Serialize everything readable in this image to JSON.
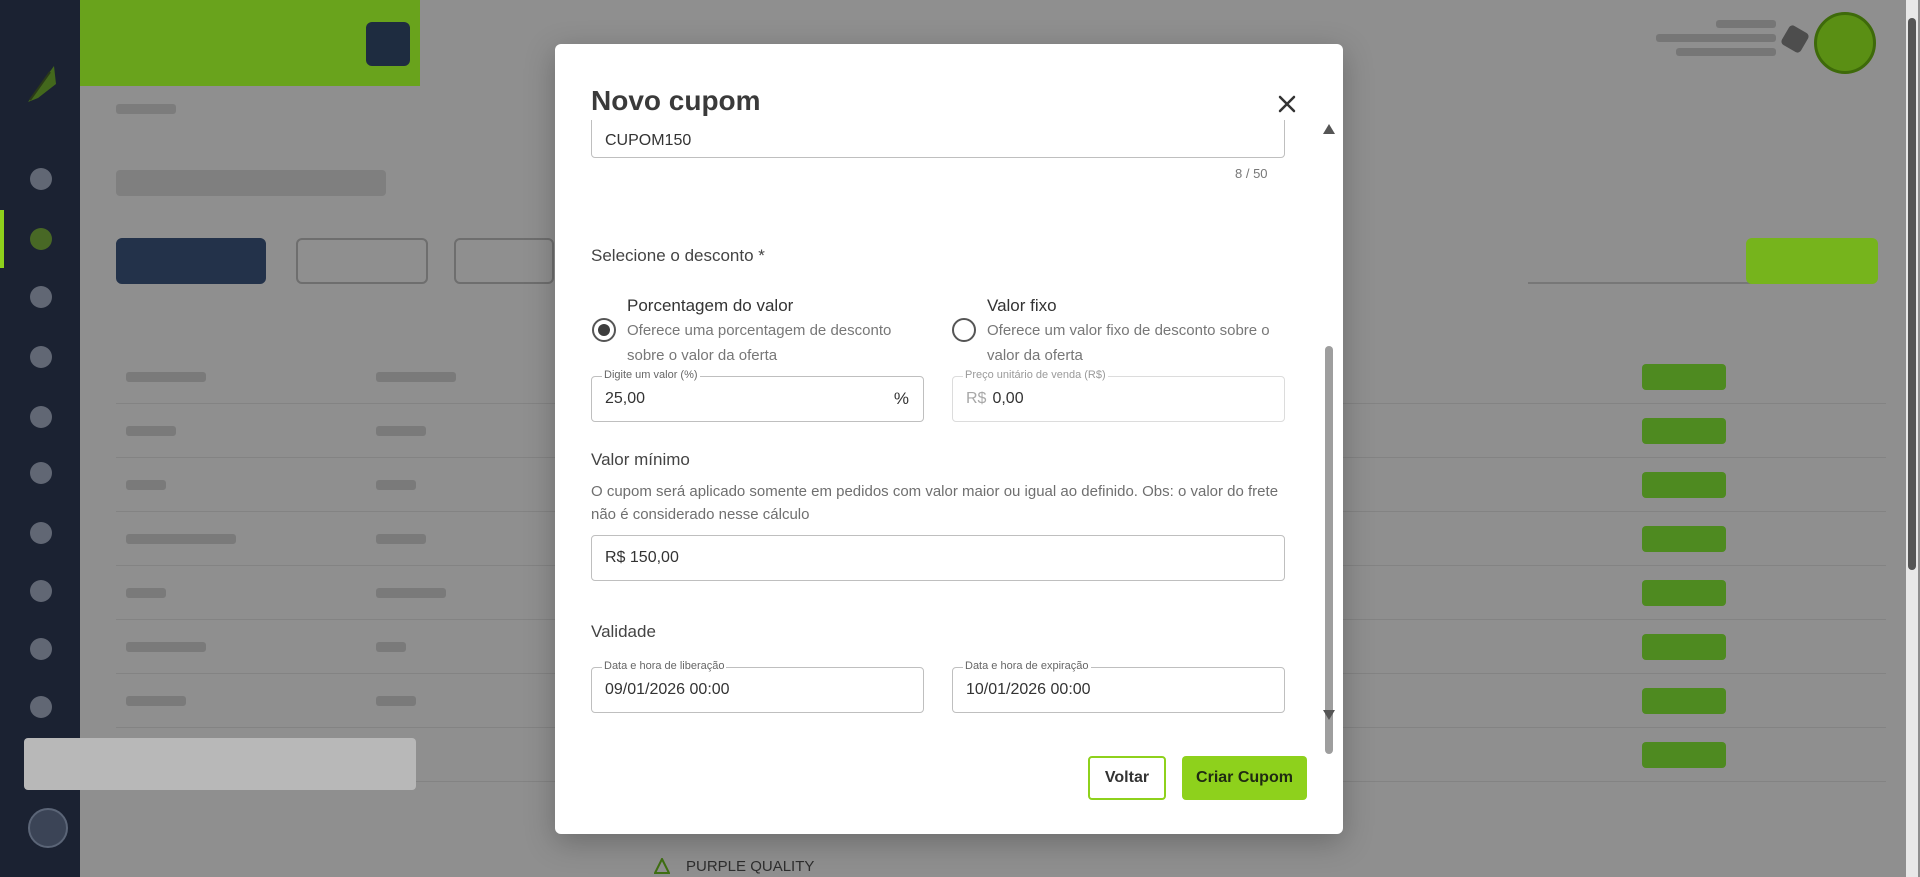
{
  "modal": {
    "title": "Novo cupom",
    "code_field": {
      "value": "CUPOM150",
      "counter": "8 / 50"
    },
    "discount_section": {
      "label": "Selecione o desconto *",
      "options": [
        {
          "title": "Porcentagem do valor",
          "description": "Oferece uma porcentagem de desconto sobre o valor da oferta",
          "selected": true
        },
        {
          "title": "Valor fixo",
          "description": "Oferece um valor fixo de desconto sobre o valor da oferta",
          "selected": false
        }
      ],
      "percent_field": {
        "label": "Digite um valor (%)",
        "value": "25,00",
        "suffix": "%"
      },
      "fixed_field": {
        "label": "Preço unitário de venda (R$)",
        "prefix": "R$",
        "value": "0,00"
      }
    },
    "minimum": {
      "label": "Valor mínimo",
      "help": "O cupom será aplicado somente em pedidos com valor maior ou igual ao definido. Obs: o valor do frete não é considerado nesse cálculo",
      "value": "R$ 150,00"
    },
    "validity": {
      "label": "Validade",
      "release_field": {
        "label": "Data e hora de liberação",
        "value": "09/01/2026 00:00"
      },
      "expiry_field": {
        "label": "Data e hora de expiração",
        "value": "10/01/2026 00:00"
      }
    },
    "buttons": {
      "back": "Voltar",
      "create": "Criar Cupom"
    }
  },
  "background": {
    "visible_text": "PURPLE QUALITY"
  },
  "colors": {
    "accent_green": "#8ed11c",
    "sidebar": "#1b2232",
    "overlay": "#8e8e8e"
  },
  "icons": [
    "close-icon",
    "logo-icon",
    "chat-icon",
    "bell-icon",
    "scroll-up-icon",
    "scroll-down-icon"
  ]
}
